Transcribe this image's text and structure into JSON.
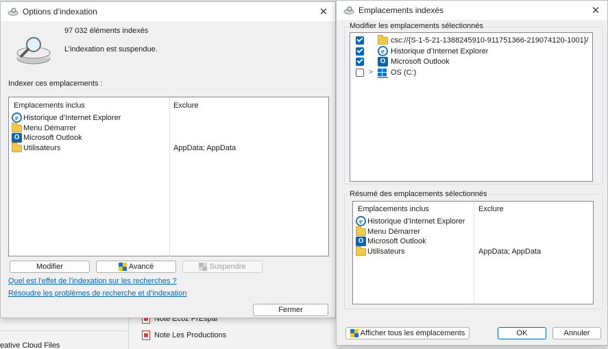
{
  "background": {
    "left_text": "eative Cloud Files",
    "item1": "Note Ecoz PrEspar",
    "item2": "Note Les Productions"
  },
  "indexing_options": {
    "title": "Options d’indexation",
    "count_text": "97 032 éléments indexés",
    "status_text": "L’indexation est suspendue.",
    "section_label": "Indexer ces emplacements :",
    "col_included": "Emplacements inclus",
    "col_exclude": "Exclure",
    "locations": [
      {
        "icon": "ie-icon",
        "label": "Historique d’Internet Explorer",
        "exclude": ""
      },
      {
        "icon": "folder-icon",
        "label": "Menu Démarrer",
        "exclude": ""
      },
      {
        "icon": "outlook-icon",
        "label": "Microsoft Outlook",
        "exclude": ""
      },
      {
        "icon": "folder-icon",
        "label": "Utilisateurs",
        "exclude": "AppData; AppData"
      }
    ],
    "btn_modify": "Modifier",
    "btn_advanced": "Avancé",
    "btn_suspend": "Suspendre",
    "link1": "Quel est l’effet de l’indexation sur les recherches ?",
    "link2": "Résoudre les problèmes de recherche et d’indexation",
    "btn_close": "Fermer"
  },
  "indexed_locations": {
    "title": "Emplacements indexés",
    "modify_label": "Modifier les emplacements sélectionnés",
    "tree": [
      {
        "checked": true,
        "expander": false,
        "icon": "folder-icon",
        "label": "csc://{S-1-5-21-1388245910-911751366-219074120-1001}/"
      },
      {
        "checked": true,
        "expander": false,
        "icon": "ie-icon",
        "label": "Historique d’Internet Explorer"
      },
      {
        "checked": true,
        "expander": false,
        "icon": "outlook-icon",
        "label": "Microsoft Outlook"
      },
      {
        "checked": false,
        "expander": true,
        "icon": "drive-icon",
        "label": "OS (C:)"
      }
    ],
    "summary_label": "Résumé des emplacements sélectionnés",
    "col_included": "Emplacements inclus",
    "col_exclude": "Exclure",
    "summary": [
      {
        "icon": "ie-icon",
        "label": "Historique d’Internet Explorer",
        "exclude": ""
      },
      {
        "icon": "folder-icon",
        "label": "Menu Démarrer",
        "exclude": ""
      },
      {
        "icon": "outlook-icon",
        "label": "Microsoft Outlook",
        "exclude": ""
      },
      {
        "icon": "folder-icon",
        "label": "Utilisateurs",
        "exclude": "AppData; AppData"
      }
    ],
    "btn_show_all": "Afficher tous les emplacements",
    "btn_ok": "OK",
    "btn_cancel": "Annuler"
  }
}
